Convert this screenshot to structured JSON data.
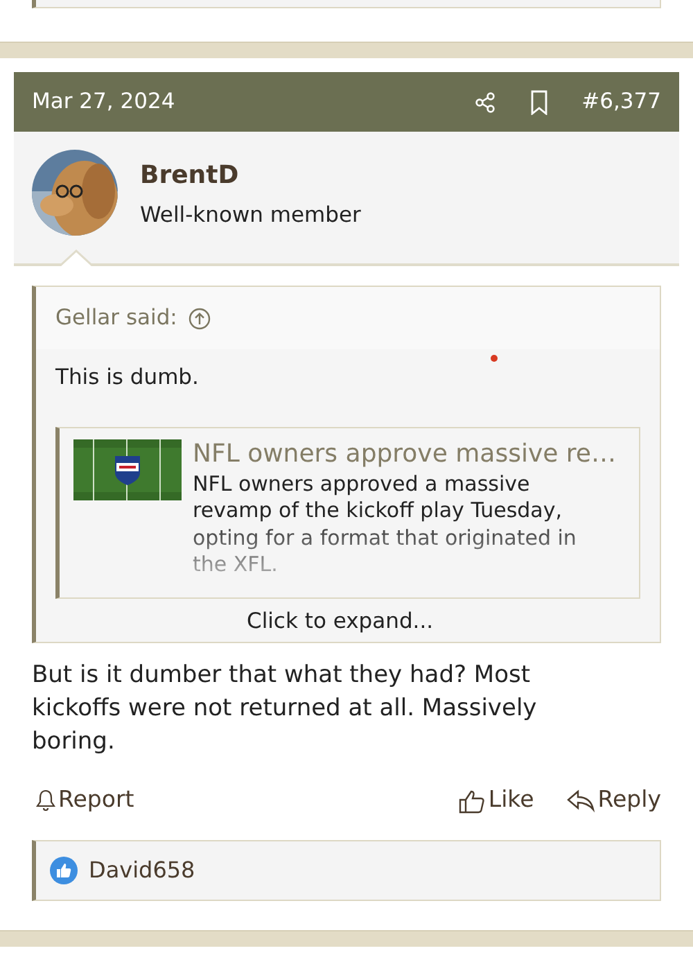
{
  "post": {
    "date": "Mar 27, 2024",
    "post_number": "#6,377",
    "author": {
      "name": "BrentD",
      "title": "Well-known member"
    },
    "quote": {
      "attribution": "Gellar said:",
      "text": "This is dumb.",
      "embed": {
        "title": "NFL owners approve massive re…",
        "description": "NFL owners approved a massive revamp of the kickoff play Tuesday, opting for a format that originated in the XFL."
      },
      "expand_label": "Click to expand..."
    },
    "body": "But is it dumber that what they had? Most kickoffs were not returned at all. Massively boring.",
    "actions": [
      {
        "kind": "report",
        "label": "Report"
      },
      {
        "kind": "like",
        "label": "Like"
      },
      {
        "kind": "reply",
        "label": "Reply"
      }
    ],
    "reactions": {
      "users": "David658"
    }
  }
}
